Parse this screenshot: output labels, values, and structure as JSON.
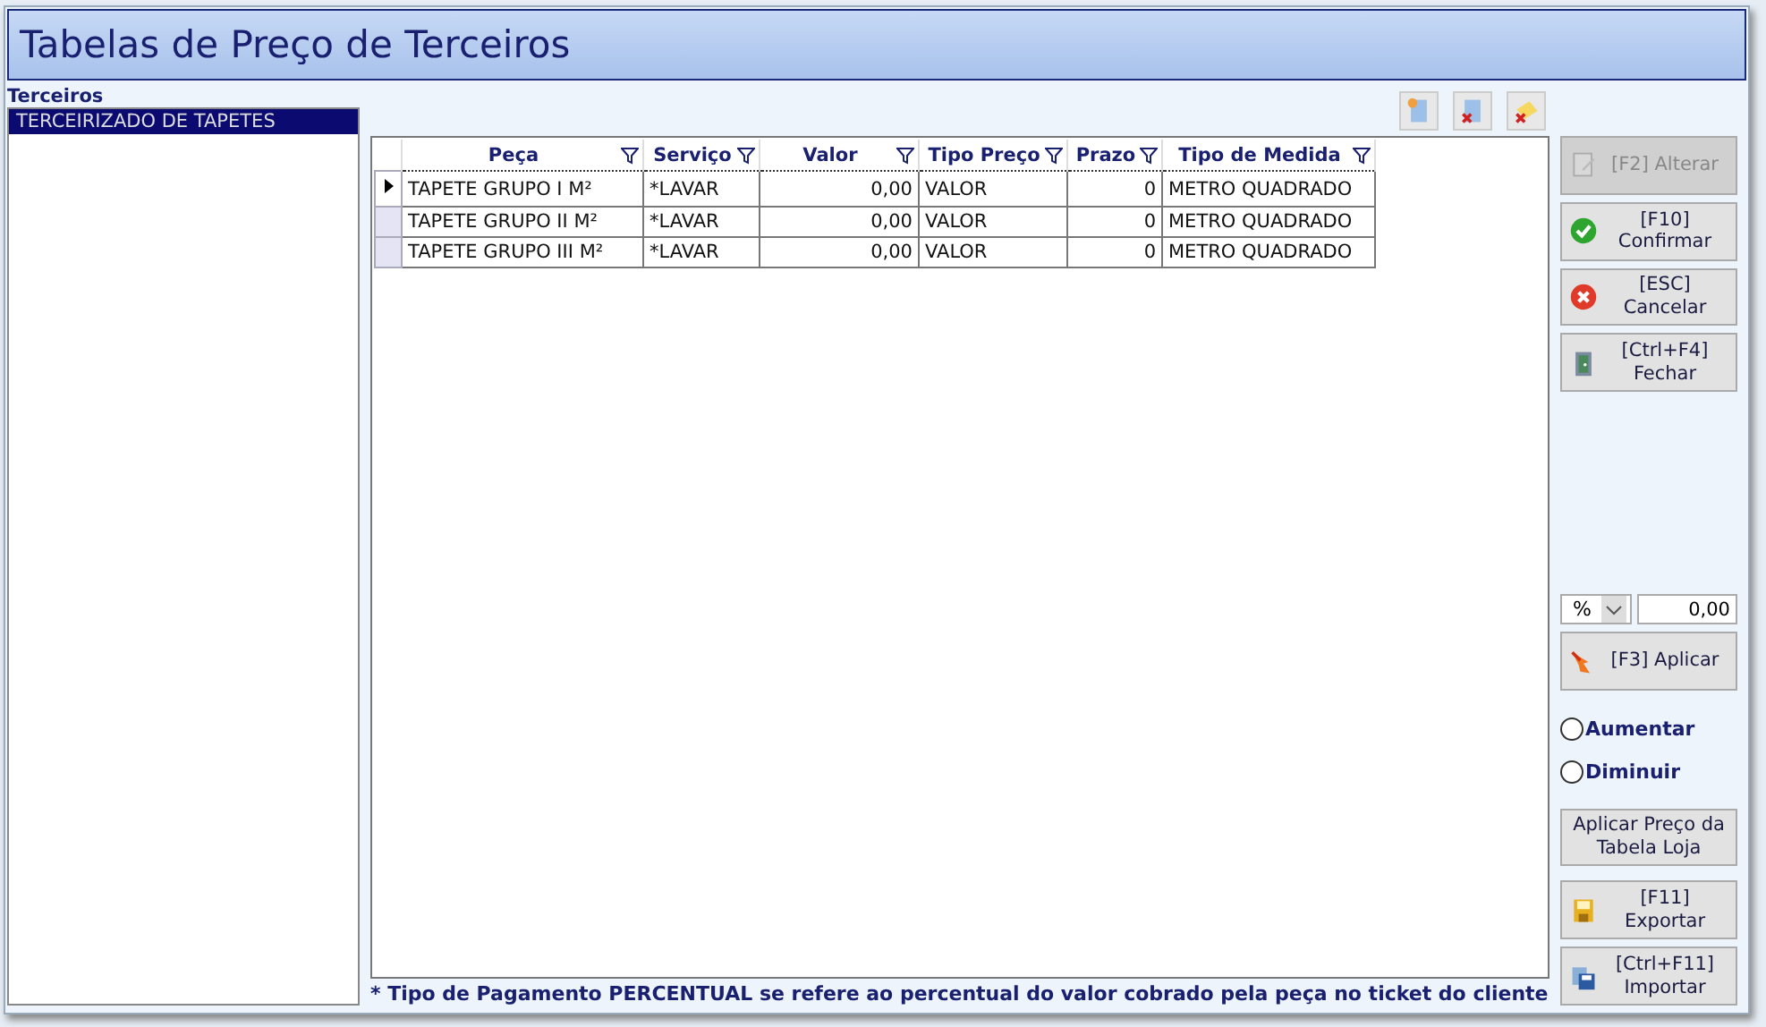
{
  "window": {
    "title": "Tabelas de Preço de Terceiros"
  },
  "terceiros": {
    "label": "Terceiros",
    "items": [
      {
        "text": "TERCEIRIZADO DE TAPETES",
        "selected": true
      }
    ]
  },
  "table": {
    "columns": [
      {
        "label": "Peça"
      },
      {
        "label": "Serviço"
      },
      {
        "label": "Valor"
      },
      {
        "label": "Tipo Preço"
      },
      {
        "label": "Prazo"
      },
      {
        "label": "Tipo de Medida"
      }
    ],
    "rows": [
      {
        "selected": true,
        "cells": [
          "TAPETE GRUPO I M²",
          "*LAVAR",
          "0,00",
          "VALOR",
          "0",
          "METRO QUADRADO"
        ]
      },
      {
        "selected": false,
        "cells": [
          "TAPETE GRUPO II M²",
          "*LAVAR",
          "0,00",
          "VALOR",
          "0",
          "METRO QUADRADO"
        ]
      },
      {
        "selected": false,
        "cells": [
          "TAPETE GRUPO III M²",
          "*LAVAR",
          "0,00",
          "VALOR",
          "0",
          "METRO QUADRADO"
        ]
      }
    ]
  },
  "actions": [
    {
      "kind": "edit",
      "lines": [
        "[F2] Alterar"
      ],
      "disabled": true
    },
    {
      "kind": "confirm",
      "lines": [
        "[F10]",
        "Confirmar"
      ],
      "disabled": false
    },
    {
      "kind": "cancel",
      "lines": [
        "[ESC]",
        "Cancelar"
      ],
      "disabled": false
    },
    {
      "kind": "close",
      "lines": [
        "[Ctrl+F4]",
        "Fechar"
      ],
      "disabled": false
    }
  ],
  "adjust": {
    "unit": "%",
    "value": "0,00",
    "apply": {
      "kind": "apply",
      "lines": [
        "[F3] Aplicar"
      ],
      "disabled": false
    },
    "options": [
      {
        "label": "Aumentar",
        "selected": false
      },
      {
        "label": "Diminuir",
        "selected": false
      }
    ],
    "store_price": {
      "lines": [
        "Aplicar Preço da",
        "Tabela Loja"
      ],
      "disabled": false
    }
  },
  "transfer": [
    {
      "kind": "export",
      "lines": [
        "[F11]",
        "Exportar"
      ],
      "disabled": false
    },
    {
      "kind": "import",
      "lines": [
        "[Ctrl+F11]",
        "Importar"
      ],
      "disabled": false
    }
  ],
  "footnote": "* Tipo de Pagamento PERCENTUAL se refere ao percentual do valor cobrado pela peça no ticket do cliente"
}
